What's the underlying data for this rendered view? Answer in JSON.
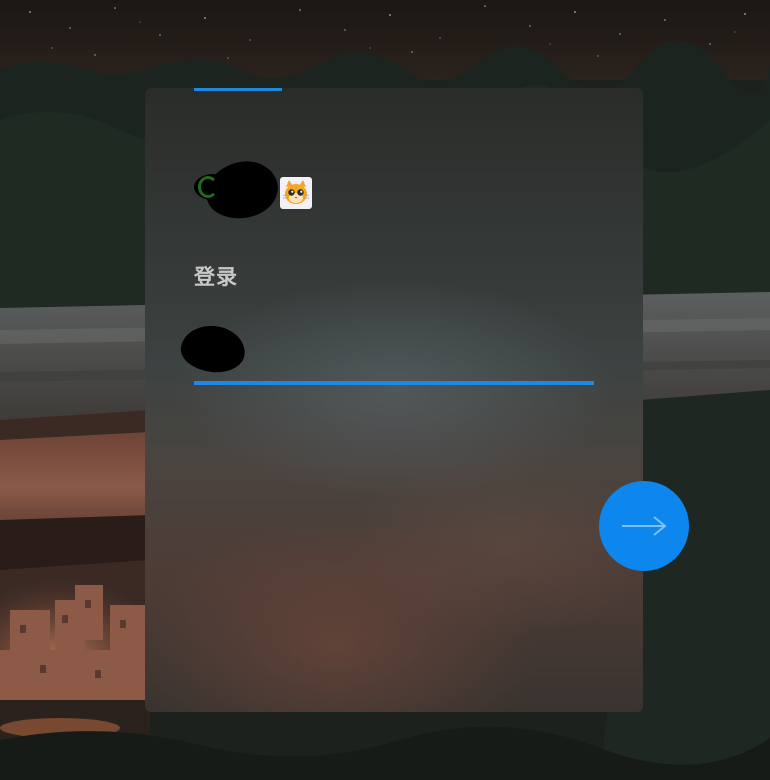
{
  "login": {
    "title": "登录",
    "username_value": "",
    "username_placeholder": ""
  },
  "icons": {
    "brand_emoji": "cat-face-icon",
    "submit": "arrow-right-icon"
  },
  "colors": {
    "accent": "#1e88e5",
    "button": "#0d87ee",
    "title_text": "#c8c8c8"
  }
}
